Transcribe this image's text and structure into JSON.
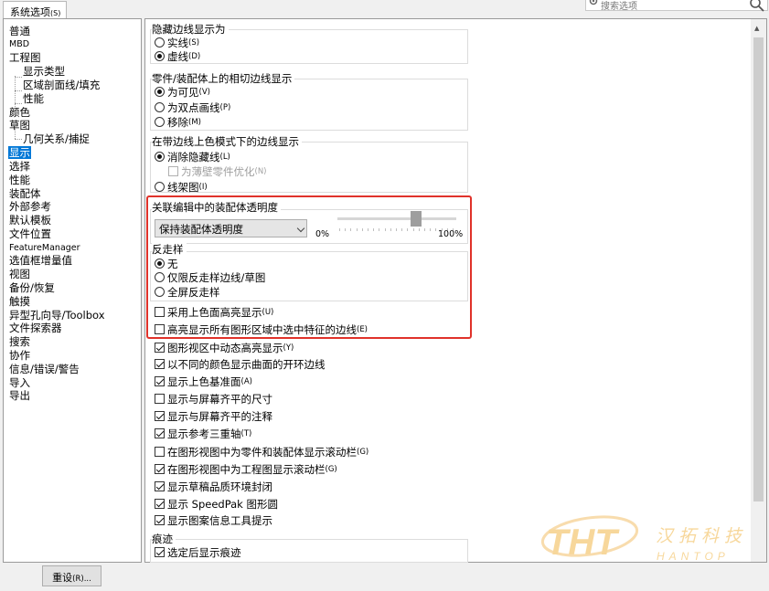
{
  "tab": {
    "label": "系统选项",
    "hotkey": "(S)"
  },
  "search": {
    "placeholder": "搜索选项"
  },
  "tree": {
    "items": [
      "普通",
      "MBD",
      "工程图",
      "显示类型",
      "区域剖面线/填充",
      "性能",
      "颜色",
      "草图",
      "几何关系/捕捉",
      "显示",
      "选择",
      "性能",
      "装配体",
      "外部参考",
      "默认模板",
      "文件位置",
      "FeatureManager",
      "选值框增量值",
      "视图",
      "备份/恢复",
      "触摸",
      "异型孔向导/Toolbox",
      "文件探索器",
      "搜索",
      "协作",
      "信息/错误/警告",
      "导入",
      "导出"
    ],
    "selected_index": 9
  },
  "hidden_edges": {
    "title": "隐藏边线显示为",
    "options": [
      {
        "label": "实线",
        "hotkey": "(S)",
        "selected": false
      },
      {
        "label": "虚线",
        "hotkey": "(D)",
        "selected": true
      }
    ]
  },
  "tangent_edges": {
    "title": "零件/装配体上的相切边线显示",
    "options": [
      {
        "label": "为可见",
        "hotkey": "(V)",
        "selected": true
      },
      {
        "label": "为双点画线",
        "hotkey": "(P)",
        "selected": false
      },
      {
        "label": "移除",
        "hotkey": "(M)",
        "selected": false
      }
    ]
  },
  "shaded_edges": {
    "title": "在带边线上色模式下的边线显示",
    "opt1": {
      "label": "消除隐藏线",
      "hotkey": "(L)",
      "selected": true
    },
    "sub": {
      "label": "为薄壁零件优化",
      "hotkey": "(N)",
      "checked": false,
      "disabled": true
    },
    "opt2": {
      "label": "线架图",
      "hotkey": "(I)",
      "selected": false
    }
  },
  "transparency": {
    "title": "关联编辑中的装配体透明度",
    "select_value": "保持装配体透明度",
    "min_label": "0%",
    "max_label": "100%",
    "slider_value": 0.65
  },
  "antialias": {
    "title": "反走样",
    "options": [
      {
        "label": "无",
        "selected": true
      },
      {
        "label": "仅限反走样边线/草图",
        "selected": false
      },
      {
        "label": "全屏反走样",
        "selected": false
      }
    ]
  },
  "highlight": {
    "opt1": {
      "label": "采用上色面高亮显示",
      "hotkey": "(U)",
      "checked": false
    },
    "opt2": {
      "label": "高亮显示所有图形区域中选中特征的边线",
      "hotkey": "(E)",
      "checked": false
    }
  },
  "checks": [
    {
      "label": "图形视区中动态高亮显示",
      "hotkey": "(Y)",
      "checked": true
    },
    {
      "label": "以不同的颜色显示曲面的开环边线",
      "hotkey": "",
      "checked": true
    },
    {
      "label": "显示上色基准面",
      "hotkey": "(A)",
      "checked": true
    },
    {
      "label": "显示与屏幕齐平的尺寸",
      "hotkey": "",
      "checked": false
    },
    {
      "label": "显示与屏幕齐平的注释",
      "hotkey": "",
      "checked": true
    },
    {
      "label": "显示参考三重轴",
      "hotkey": "(T)",
      "checked": true
    },
    {
      "label": "在图形视图中为零件和装配体显示滚动栏",
      "hotkey": "(G)",
      "checked": false
    },
    {
      "label": "在图形视图中为工程图显示滚动栏",
      "hotkey": "(G)",
      "checked": true
    },
    {
      "label": "显示草稿品质环境封闭",
      "hotkey": "",
      "checked": true
    },
    {
      "label": "显示 SpeedPak 图形圆",
      "hotkey": "",
      "checked": true
    },
    {
      "label": "显示图案信息工具提示",
      "hotkey": "",
      "checked": true
    }
  ],
  "trail": {
    "title": "痕迹",
    "opt": {
      "label": "选定后显示痕迹",
      "checked": true
    }
  },
  "reset_button": {
    "label": "重设",
    "hotkey": "(R)..."
  },
  "watermark": {
    "logo": "THT",
    "cn": "汉拓科技",
    "en": "HANTOP"
  }
}
